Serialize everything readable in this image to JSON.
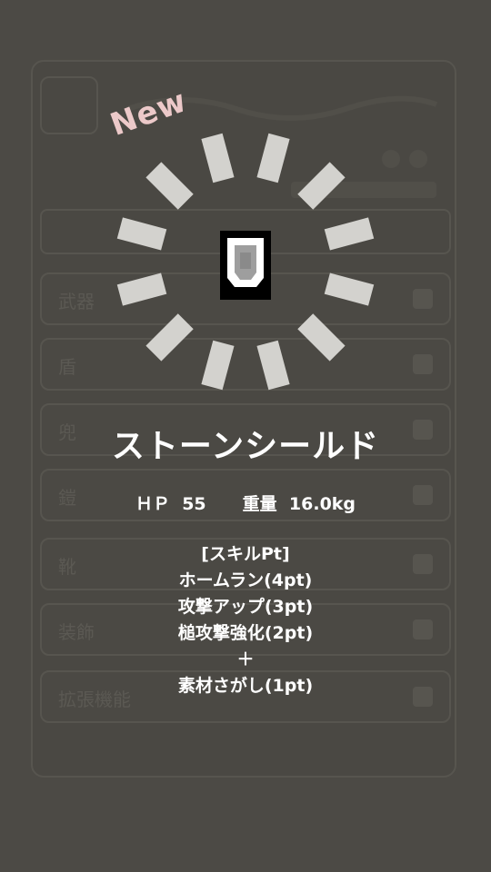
{
  "badge": {
    "label": "New"
  },
  "item": {
    "name": "ストーンシールド",
    "hp_label": "ＨＰ",
    "hp_value": "55",
    "weight_label": "重量",
    "weight_value": "16.0kg",
    "icon": "shield-icon"
  },
  "skills": {
    "header": "[スキルPt]",
    "lines": [
      "ホームラン(4pt)",
      "攻撃アップ(3pt)",
      "槌攻撃強化(2pt)",
      "＋",
      "素材さがし(1pt)"
    ]
  },
  "background_menu": {
    "rows": [
      "武器",
      "盾",
      "兜",
      "鎧",
      "靴",
      "装飾",
      "拡張機能"
    ]
  },
  "colors": {
    "background": "#4c4a45",
    "burst": "#d3d2ce",
    "badge": "#ecc9c9",
    "text": "#ffffff"
  }
}
